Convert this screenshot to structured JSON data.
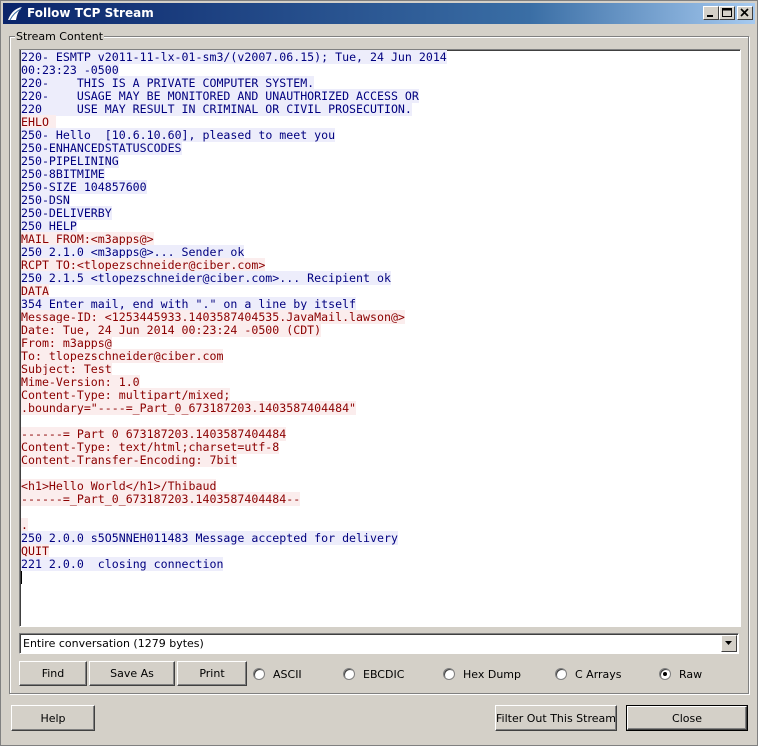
{
  "window": {
    "title": "Follow TCP Stream"
  },
  "group": {
    "label": "Stream Content"
  },
  "stream": {
    "lines": [
      {
        "kind": "server",
        "segments": [
          {
            "t": "220-"
          },
          {
            "r": 158
          },
          {
            "t": " ESMTP v2011-11-lx-01-sm3/(v2007.06.15); Tue, 24 Jun 2014"
          }
        ]
      },
      {
        "kind": "server",
        "segments": [
          {
            "t": "00:23:23 -0500"
          }
        ]
      },
      {
        "kind": "server",
        "segments": [
          {
            "t": "220-    THIS IS A PRIVATE COMPUTER SYSTEM."
          }
        ]
      },
      {
        "kind": "server",
        "segments": [
          {
            "t": "220-    USAGE MAY BE MONITORED AND UNAUTHORIZED ACCESS OR"
          }
        ]
      },
      {
        "kind": "server",
        "segments": [
          {
            "t": "220     USE MAY RESULT IN CRIMINAL OR CIVIL PROSECUTION."
          }
        ]
      },
      {
        "kind": "client",
        "segments": [
          {
            "t": "EHLO "
          },
          {
            "r": 78
          }
        ]
      },
      {
        "kind": "server",
        "segments": [
          {
            "t": "250-"
          },
          {
            "r": 158
          },
          {
            "t": " Hello "
          },
          {
            "r": 152
          },
          {
            "t": " [10.6.10.60], pleased to meet you"
          }
        ]
      },
      {
        "kind": "server",
        "segments": [
          {
            "t": "250-ENHANCEDSTATUSCODES"
          }
        ]
      },
      {
        "kind": "server",
        "segments": [
          {
            "t": "250-PIPELINING"
          }
        ]
      },
      {
        "kind": "server",
        "segments": [
          {
            "t": "250-8BITMIME"
          }
        ]
      },
      {
        "kind": "server",
        "segments": [
          {
            "t": "250-SIZE 104857600"
          }
        ]
      },
      {
        "kind": "server",
        "segments": [
          {
            "t": "250-DSN"
          }
        ]
      },
      {
        "kind": "server",
        "segments": [
          {
            "t": "250-DELIVERBY"
          }
        ]
      },
      {
        "kind": "server",
        "segments": [
          {
            "t": "250 HELP"
          }
        ]
      },
      {
        "kind": "client",
        "segments": [
          {
            "t": "MAIL FROM:<m3apps@"
          },
          {
            "r": 72
          },
          {
            "t": ">"
          }
        ]
      },
      {
        "kind": "server",
        "segments": [
          {
            "t": "250 2.1.0 <m3apps@"
          },
          {
            "r": 72
          },
          {
            "t": ">... Sender ok"
          }
        ]
      },
      {
        "kind": "client",
        "segments": [
          {
            "t": "RCPT TO:<tlopezschneider@ciber.com>"
          }
        ]
      },
      {
        "kind": "server",
        "segments": [
          {
            "t": "250 2.1.5 <tlopezschneider@ciber.com>... Recipient ok"
          }
        ]
      },
      {
        "kind": "client",
        "segments": [
          {
            "t": "DATA"
          }
        ]
      },
      {
        "kind": "server",
        "segments": [
          {
            "t": "354 Enter mail, end with \".\" on a line by itself"
          }
        ]
      },
      {
        "kind": "client",
        "segments": [
          {
            "t": "Message-ID: <1253445933.1403587404535.JavaMail.lawson@"
          },
          {
            "r": 72
          },
          {
            "t": ">"
          }
        ]
      },
      {
        "kind": "client",
        "segments": [
          {
            "t": "Date: Tue, 24 Jun 2014 00:23:24 -0500 (CDT)"
          }
        ]
      },
      {
        "kind": "client",
        "segments": [
          {
            "t": "From: m3apps@"
          },
          {
            "r": 72
          }
        ]
      },
      {
        "kind": "client",
        "segments": [
          {
            "t": "To: tlopezschneider@ciber.com"
          }
        ]
      },
      {
        "kind": "client",
        "segments": [
          {
            "t": "Subject: Test"
          }
        ]
      },
      {
        "kind": "client",
        "segments": [
          {
            "t": "Mime-Version: 1.0"
          }
        ]
      },
      {
        "kind": "client",
        "segments": [
          {
            "t": "Content-Type: multipart/mixed;"
          }
        ]
      },
      {
        "kind": "client",
        "segments": [
          {
            "t": ".boundary=\"----=_Part_0_673187203.1403587404484\""
          }
        ]
      },
      {
        "kind": "client",
        "segments": [
          {
            "t": ""
          }
        ]
      },
      {
        "kind": "client",
        "segments": [
          {
            "t": "------=_Part_0_673187203.1403587404484"
          }
        ]
      },
      {
        "kind": "client",
        "segments": [
          {
            "t": "Content-Type: text/html;charset=utf-8"
          }
        ]
      },
      {
        "kind": "client",
        "segments": [
          {
            "t": "Content-Transfer-Encoding: 7bit"
          }
        ]
      },
      {
        "kind": "client",
        "segments": [
          {
            "t": ""
          }
        ]
      },
      {
        "kind": "client",
        "segments": [
          {
            "t": "<h1>Hello World</h1>/Thibaud"
          }
        ]
      },
      {
        "kind": "client",
        "segments": [
          {
            "t": "------=_Part_0_673187203.1403587404484--"
          }
        ]
      },
      {
        "kind": "client",
        "segments": [
          {
            "t": ""
          }
        ]
      },
      {
        "kind": "client",
        "segments": [
          {
            "t": "."
          }
        ]
      },
      {
        "kind": "server",
        "segments": [
          {
            "t": "250 2.0.0 s5O5NNEH011483 Message accepted for delivery"
          }
        ]
      },
      {
        "kind": "client",
        "segments": [
          {
            "t": "QUIT"
          }
        ]
      },
      {
        "kind": "server",
        "segments": [
          {
            "t": "221 2.0.0 "
          },
          {
            "r": 152
          },
          {
            "t": " closing connection"
          }
        ]
      }
    ]
  },
  "conversation": {
    "selected": "Entire conversation (1279 bytes)"
  },
  "buttons": {
    "find": "Find",
    "save_as": "Save As",
    "print": "Print",
    "help": "Help",
    "filter_out": "Filter Out This Stream",
    "close": "Close"
  },
  "formats": {
    "selected": "Raw",
    "options": [
      "ASCII",
      "EBCDIC",
      "Hex Dump",
      "C Arrays",
      "Raw"
    ]
  },
  "colors": {
    "client_text": "#8b0000",
    "client_bg": "#fbeded",
    "server_text": "#00007f",
    "server_bg": "#ededfb"
  }
}
